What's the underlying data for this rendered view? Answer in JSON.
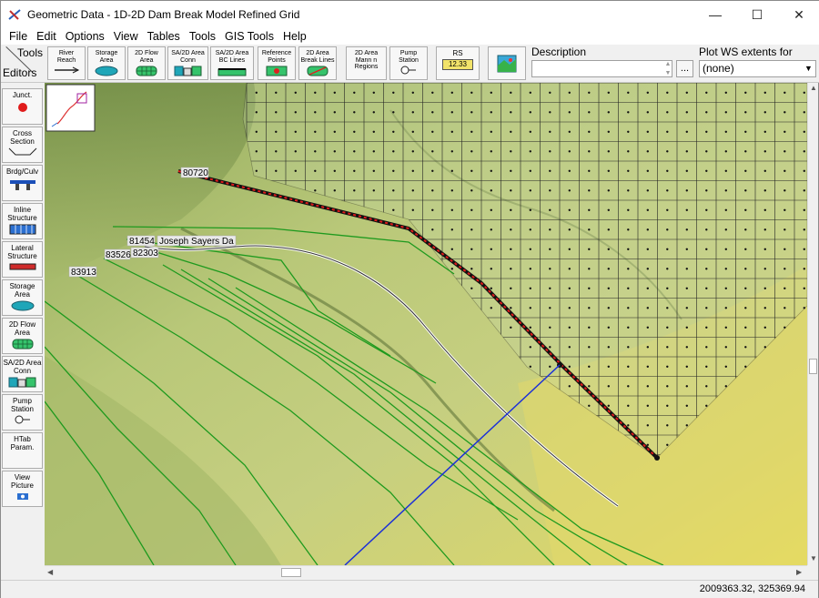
{
  "window": {
    "title": "Geometric Data - 1D-2D Dam Break Model Refined Grid",
    "controls": [
      "—",
      "☐",
      "✕"
    ]
  },
  "menu": [
    "File",
    "Edit",
    "Options",
    "View",
    "Tables",
    "Tools",
    "GIS Tools",
    "Help"
  ],
  "toolbar": {
    "tools_label": "Tools",
    "editors_label": "Editors",
    "buttons": [
      {
        "label": "River\nReach",
        "icon": "river-reach-icon"
      },
      {
        "label": "Storage\nArea",
        "icon": "storage-area-icon"
      },
      {
        "label": "2D Flow\nArea",
        "icon": "2d-flow-area-icon"
      },
      {
        "label": "SA/2D Area\nConn",
        "icon": "sa-2d-conn-icon"
      },
      {
        "label": "SA/2D Area\nBC Lines",
        "icon": "bc-lines-icon"
      },
      {
        "label": "Reference\nPoints",
        "icon": "reference-points-icon"
      },
      {
        "label": "2D Area\nBreak Lines",
        "icon": "break-lines-icon"
      },
      {
        "label": "2D Area\nMann n\nRegions",
        "icon": "mann-n-regions-icon"
      },
      {
        "label": "Pump\nStation",
        "icon": "pump-station-icon"
      },
      {
        "label": "RS",
        "icon": "rs-icon",
        "value": "12.33"
      },
      {
        "label": "",
        "icon": "background-map-icon"
      }
    ],
    "description_label": "Description",
    "description_value": "",
    "description_more": "...",
    "plot_ws_label": "Plot WS extents for Profile:",
    "plot_ws_value": "(none)"
  },
  "editors": [
    {
      "label": "Junct.",
      "icon": "junction-icon"
    },
    {
      "label": "Cross\nSection",
      "icon": "cross-section-icon"
    },
    {
      "label": "Brdg/Culv",
      "icon": "bridge-culvert-icon"
    },
    {
      "label": "Inline\nStructure",
      "icon": "inline-structure-icon"
    },
    {
      "label": "Lateral\nStructure",
      "icon": "lateral-structure-icon"
    },
    {
      "label": "Storage\nArea",
      "icon": "storage-area-icon"
    },
    {
      "label": "2D Flow\nArea",
      "icon": "2d-flow-area-icon"
    },
    {
      "label": "SA/2D Area\nConn",
      "icon": "sa-2d-conn-icon"
    },
    {
      "label": "Pump\nStation",
      "icon": "pump-station-icon"
    },
    {
      "label": "HTab\nParam.",
      "icon": "htab-icon"
    },
    {
      "label": "View\nPicture",
      "icon": "camera-icon"
    }
  ],
  "map": {
    "labels": [
      "80720",
      "81454",
      "Joseph Sayers Da",
      "82303",
      "83526",
      "83913"
    ]
  },
  "status": {
    "coordinates": "2009363.32, 325369.94"
  }
}
